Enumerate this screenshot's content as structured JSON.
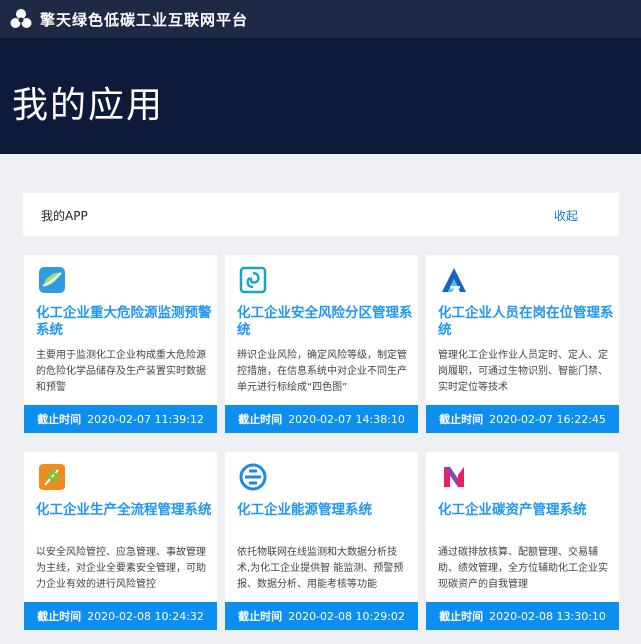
{
  "header": {
    "brand": "擎天绿色低碳工业互联网平台"
  },
  "hero": {
    "title": "我的应用"
  },
  "app_section": {
    "label": "我的APP",
    "collapse": "收起"
  },
  "deadline_label": "截止时间",
  "cards": [
    {
      "title": "化工企业重大危险源监测预警系统",
      "desc": "主要用于监测化工企业构成重大危险源的危险化学品储存及生产装置实时数据和预警",
      "deadline": "2020-02-07 11:39:12"
    },
    {
      "title": "化工企业安全风险分区管理系统",
      "desc": "辨识企业风险，确定风险等级，制定管控措施，在信息系统中对企业不同生产单元进行标绘成“四色图”",
      "deadline": "2020-02-07 14:38:10"
    },
    {
      "title": "化工企业人员在岗在位管理系统",
      "desc": "管理化工企业作业人员定时、定人、定岗履职，可通过生物识别、智能门禁、实时定位等技术",
      "deadline": "2020-02-07 16:22:45"
    },
    {
      "title": "化工企业生产全流程管理系统",
      "desc": "以安全风险管控、应急管理、事故管理为主线，对企业全要素安全管理，可助力企业有效的进行风险管控",
      "deadline": "2020-02-08 10:24:32"
    },
    {
      "title": "化工企业能源管理系统",
      "desc": "依托物联网在线监测和大数据分析技术,为化工企业提供智 能监测、预警预报、数据分析、用能考核等功能",
      "deadline": "2020-02-08 10:29:02"
    },
    {
      "title": "化工企业碳资产管理系统",
      "desc": "通过碳排放核算、配额管理、交易辅助、绩效管理，全方位辅助化工企业实现碳资产的自我管理",
      "deadline": "2020-02-08 13:30:10"
    }
  ],
  "icons": [
    "leaf-wave-icon",
    "swirl-icon",
    "a-logo-icon",
    "wheat-icon",
    "e-logo-icon",
    "ribbon-icon"
  ]
}
